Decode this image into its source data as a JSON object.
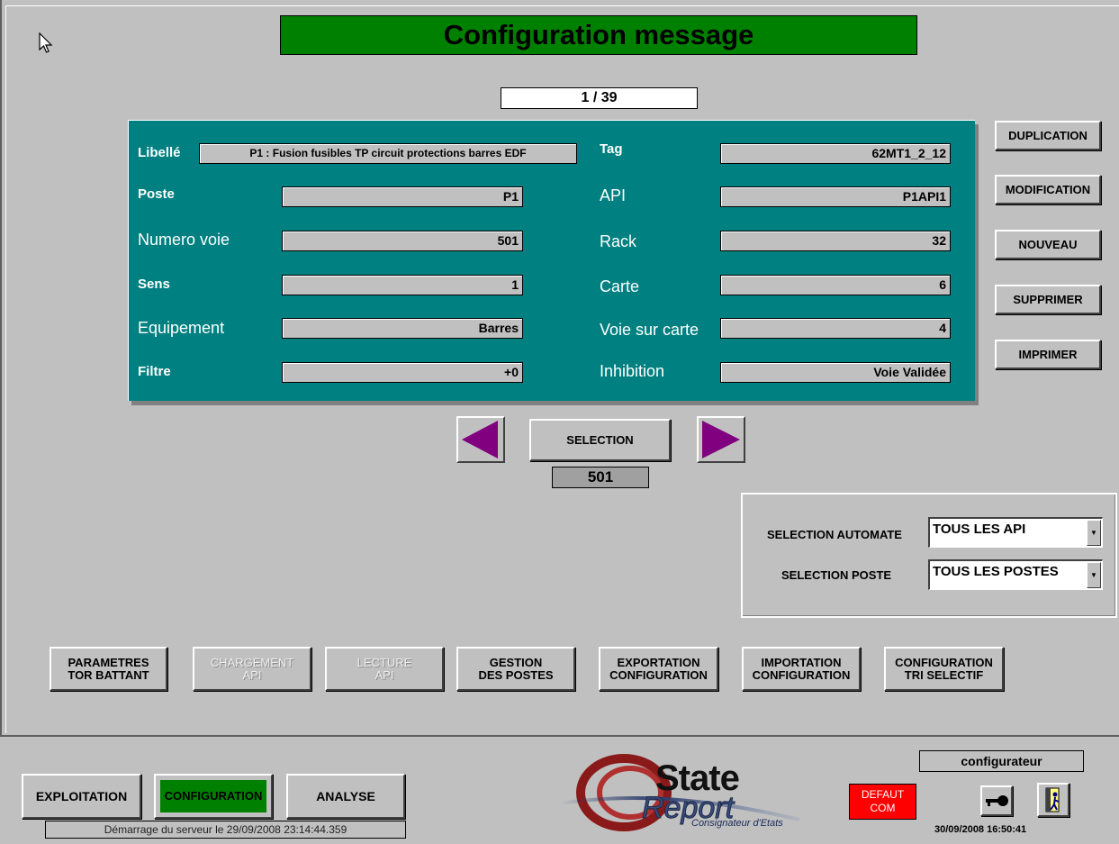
{
  "title": "Configuration message",
  "counter": "1 / 39",
  "fields": {
    "libelle": {
      "label": "Libellé",
      "value": "P1 : Fusion fusibles TP circuit protections barres EDF"
    },
    "tag": {
      "label": "Tag",
      "value": "62MT1_2_12"
    },
    "poste": {
      "label": "Poste",
      "value": "P1"
    },
    "api": {
      "label": "API",
      "value": "P1API1"
    },
    "numero_voie": {
      "label": "Numero voie",
      "value": "501"
    },
    "rack": {
      "label": "Rack",
      "value": "32"
    },
    "sens": {
      "label": "Sens",
      "value": "1"
    },
    "carte": {
      "label": "Carte",
      "value": "6"
    },
    "equipement": {
      "label": "Equipement",
      "value": "Barres"
    },
    "voie_sur_carte": {
      "label": "Voie sur carte",
      "value": "4"
    },
    "filtre": {
      "label": "Filtre",
      "value": "+0"
    },
    "inhibition": {
      "label": "Inhibition",
      "value": "Voie Validée"
    }
  },
  "side_buttons": {
    "duplication": "DUPLICATION",
    "modification": "MODIFICATION",
    "nouveau": "NOUVEAU",
    "supprimer": "SUPPRIMER",
    "imprimer": "IMPRIMER"
  },
  "navigation": {
    "selection_label": "SELECTION",
    "selection_value": "501",
    "arrow_color": "#800080"
  },
  "filters": {
    "automate_label": "SELECTION AUTOMATE",
    "automate_value": "TOUS LES API",
    "poste_label": "SELECTION POSTE",
    "poste_value": "TOUS LES POSTES"
  },
  "bottom_buttons": {
    "parametres": {
      "line1": "PARAMETRES",
      "line2": "TOR BATTANT"
    },
    "chargement": {
      "line1": "CHARGEMENT",
      "line2": "API"
    },
    "lecture": {
      "line1": "LECTURE",
      "line2": "API"
    },
    "gestion": {
      "line1": "GESTION",
      "line2": "DES POSTES"
    },
    "exportation": {
      "line1": "EXPORTATION",
      "line2": "CONFIGURATION"
    },
    "importation": {
      "line1": "IMPORTATION",
      "line2": "CONFIGURATION"
    },
    "tri": {
      "line1": "CONFIGURATION",
      "line2": "TRI SELECTIF"
    }
  },
  "footer": {
    "exploitation": "EXPLOITATION",
    "configuration": "CONFIGURATION",
    "analyse": "ANALYSE",
    "status": "Démarrage du serveur le 29/09/2008  23:14:44.359",
    "logo_word1": "State",
    "logo_word2": "Report",
    "logo_tagline": "Consignateur d'Etats",
    "defaut_line1": "DEFAUT",
    "defaut_line2": "COM",
    "user": "configurateur",
    "datetime": "30/09/2008 16:50:41"
  },
  "colors": {
    "title_bg": "#008000",
    "panel_bg": "#008080",
    "active_tab": "#008000",
    "defaut_bg": "#ff0000"
  }
}
